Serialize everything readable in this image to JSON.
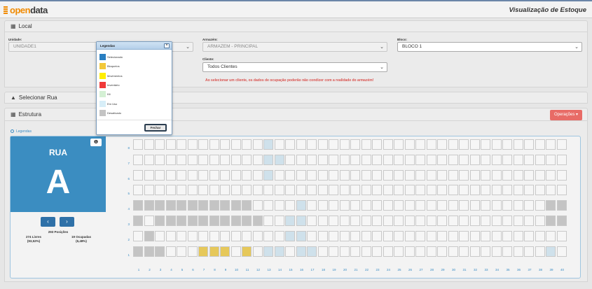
{
  "header": {
    "logo_prefix": "open",
    "logo_suffix": "data",
    "page_title": "Visualização de Estoque"
  },
  "local": {
    "title": "Local",
    "unidade": {
      "label": "Unidade:",
      "value": "UNIDADE1"
    },
    "armazem": {
      "label": "Armazém:",
      "value": "ARMAZEM - PRINCIPAL"
    },
    "bloco": {
      "label": "Bloco:",
      "value": "BLOCO 1"
    },
    "cliente": {
      "label": "Cliente:",
      "value": "Todos Clientes"
    },
    "warning": "Ao selecionar um cliente, os dados de ocupação poderão não condizer com a realidade do armazém!"
  },
  "selecionar_rua": {
    "title": "Selecionar Rua"
  },
  "estrutura": {
    "title": "Estrutura",
    "operacoes_label": "Operações ▾",
    "legendas_link": "Legendas",
    "rua_label": "RUA",
    "rua_letter": "A",
    "prev_label": "‹",
    "next_label": "›",
    "info_label": "❶",
    "posicoes": "293 Posições",
    "livres": "274 Livres",
    "livres_pct": "(93,52%)",
    "ocupadas": "19 Ocupadas",
    "ocupadas_pct": "(6,48%)"
  },
  "grid": {
    "rows": [
      "8",
      "7",
      "6",
      "5",
      "4",
      "3",
      "2",
      "1"
    ],
    "columns": [
      "1",
      "2",
      "3",
      "4",
      "5",
      "6",
      "7",
      "8",
      "9",
      "10",
      "11",
      "12",
      "13",
      "14",
      "15",
      "16",
      "17",
      "18",
      "19",
      "20",
      "21",
      "22",
      "23",
      "24",
      "25",
      "26",
      "27",
      "28",
      "29",
      "30",
      "31",
      "32",
      "33",
      "34",
      "35",
      "36",
      "37",
      "38",
      "39",
      "40"
    ],
    "colors": {
      "free": "#f6f6f6",
      "blocked": "#c4c4c4",
      "em_uso": "#cfe1eb",
      "movement": "#e6c85a"
    },
    "cells": [
      "eeeeeeeeeeeeueeeeeeeeeeeeeeeeeeeeeeeeeee",
      "eeeeeeeeeeeeuueeeeeeeeeeeeeeeeeeeeeeeeee",
      "eeeeeeeeeeeeueeeeeeeeeeeeeeeeeeeeeeeeeee",
      "eeeeeeeeeeeeeeeeeeeeeeeeeeeeeeeeeeeeeeee",
      "gggggggggggeeeeueeeeeeeeeeeeeeeeeeeeeegg",
      "geggggggggggeeuueeeeeeeeeeeeeeeeeeeeeegg",
      "egeeeeeeeeeeeeuueeeeeeeeeeeeeeeeeeeeeeee",
      "gggeeeyyyeyeuueuueeeeeeeeeeeeeeeeeeeeeue"
    ]
  },
  "legend_modal": {
    "title": "Legendas",
    "close": "×",
    "items": [
      {
        "label": "Selecionado",
        "color": "#2a7fc1"
      },
      {
        "label": "Bloqueios",
        "color": "#f2c83a"
      },
      {
        "label": "Movimentos",
        "color": "#ffee00"
      },
      {
        "label": "Inventário",
        "color": "#f03a3a"
      },
      {
        "label": "Kit",
        "color": "#d4f0d4"
      },
      {
        "label": "Em Uso",
        "color": "#d7eef8"
      },
      {
        "label": "Desativado",
        "color": "#c4c4c4"
      }
    ],
    "fechar": "Fechar"
  }
}
